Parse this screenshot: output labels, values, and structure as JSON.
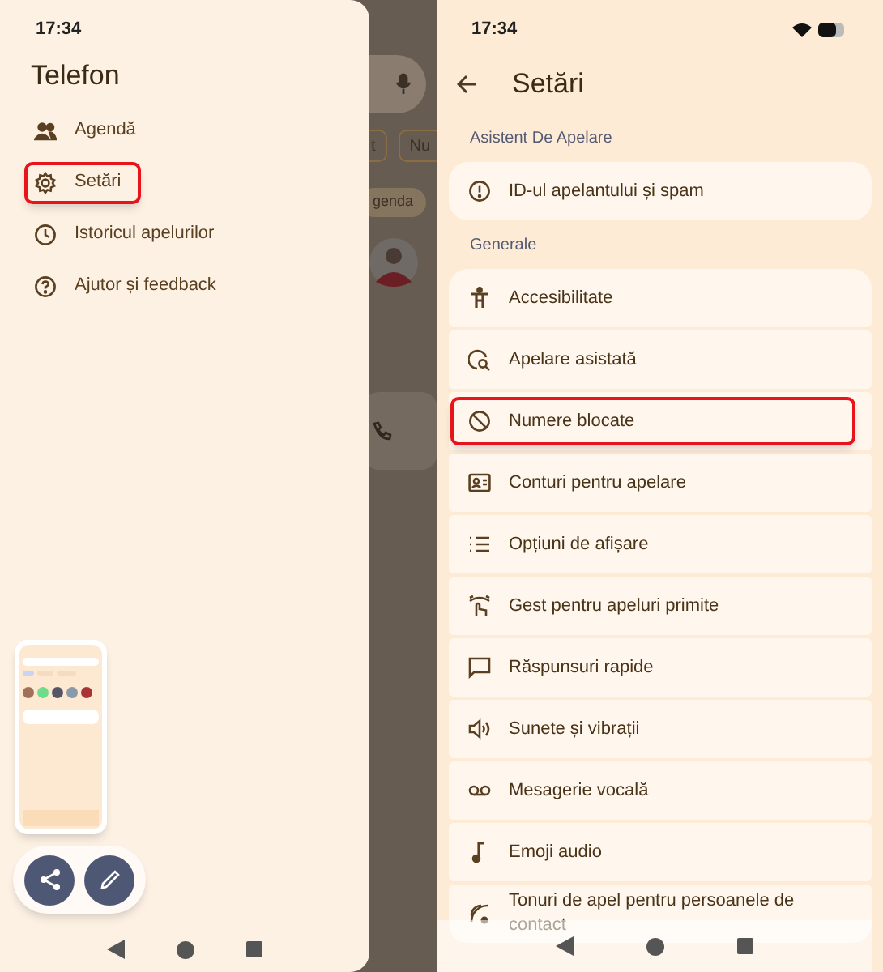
{
  "left_screen": {
    "status_bar": {
      "time": "17:34"
    },
    "drawer": {
      "title": "Telefon",
      "items": [
        {
          "label": "Agendă",
          "highlighted": false
        },
        {
          "label": "Setări",
          "highlighted": true
        },
        {
          "label": "Istoricul apelurilor",
          "highlighted": false
        },
        {
          "label": "Ajutor și feedback",
          "highlighted": false
        }
      ]
    },
    "background": {
      "chips": [
        "t",
        "Nu"
      ],
      "tab_chip": "genda"
    }
  },
  "right_screen": {
    "status_bar": {
      "time": "17:34"
    },
    "title": "Setări",
    "sections": [
      {
        "header": "Asistent De Apelare",
        "items": [
          {
            "label": "ID-ul apelantului și spam",
            "highlighted": false
          }
        ]
      },
      {
        "header": "Generale",
        "items": [
          {
            "label": "Accesibilitate",
            "highlighted": false
          },
          {
            "label": "Apelare asistată",
            "highlighted": false
          },
          {
            "label": "Numere blocate",
            "highlighted": true
          },
          {
            "label": "Conturi pentru apelare",
            "highlighted": false
          },
          {
            "label": "Opțiuni de afișare",
            "highlighted": false
          },
          {
            "label": "Gest pentru apeluri primite",
            "highlighted": false
          },
          {
            "label": "Răspunsuri rapide",
            "highlighted": false
          },
          {
            "label": "Sunete și vibrații",
            "highlighted": false
          },
          {
            "label": "Mesagerie vocală",
            "highlighted": false
          },
          {
            "label": "Emoji audio",
            "highlighted": false
          },
          {
            "label": "Tonuri de apel pentru persoanele de contact",
            "highlighted": false
          }
        ]
      }
    ]
  }
}
